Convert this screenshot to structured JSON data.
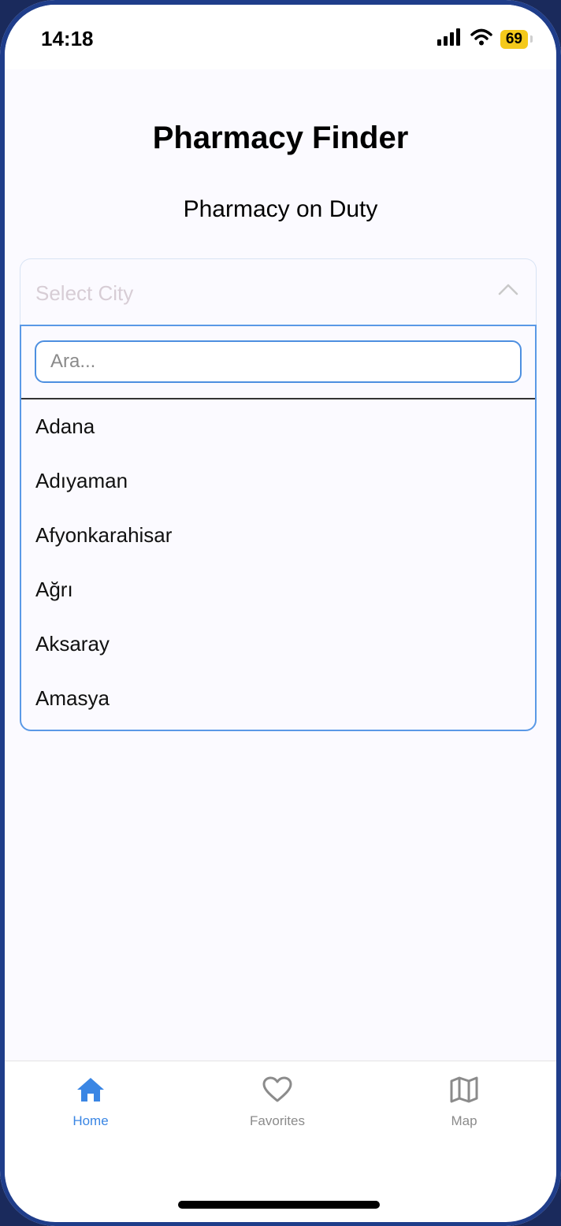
{
  "status_bar": {
    "time": "14:18",
    "battery": "69"
  },
  "header": {
    "title": "Pharmacy Finder",
    "subtitle": "Pharmacy on Duty"
  },
  "city_select": {
    "placeholder": "Select City",
    "search_placeholder": "Ara...",
    "options": [
      "Adana",
      "Adıyaman",
      "Afyonkarahisar",
      "Ağrı",
      "Aksaray",
      "Amasya"
    ]
  },
  "tabs": [
    {
      "label": "Home",
      "icon": "home-icon",
      "active": true
    },
    {
      "label": "Favorites",
      "icon": "heart-icon",
      "active": false
    },
    {
      "label": "Map",
      "icon": "map-icon",
      "active": false
    }
  ],
  "colors": {
    "accent": "#3a86e4",
    "inactive": "#8b8b8b",
    "battery": "#f4c91b"
  }
}
